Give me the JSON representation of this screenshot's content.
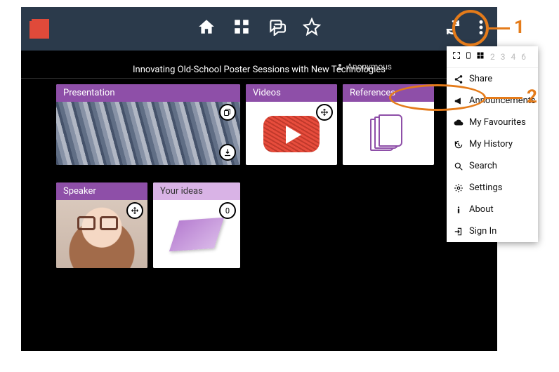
{
  "header": {
    "app_color": "#2b3a4b",
    "logo_color": "#e04a3a"
  },
  "title_bar": {
    "title": "Innovating Old-School Poster Sessions with New Technologies",
    "user_label": "Anonymous"
  },
  "panel": {
    "zoom_levels": [
      "2",
      "3",
      "4",
      "6"
    ],
    "items": [
      {
        "icon": "share-icon",
        "label": "Share"
      },
      {
        "icon": "megaphone-icon",
        "label": "Announcements"
      },
      {
        "icon": "cloud-icon",
        "label": "My Favourites"
      },
      {
        "icon": "history-icon",
        "label": "My History"
      },
      {
        "icon": "search-icon",
        "label": "Search"
      },
      {
        "icon": "gear-icon",
        "label": "Settings"
      },
      {
        "icon": "info-icon",
        "label": "About"
      },
      {
        "icon": "signin-icon",
        "label": "Sign In"
      }
    ]
  },
  "cards": {
    "presentation": {
      "title": "Presentation"
    },
    "videos": {
      "title": "Videos"
    },
    "references": {
      "title": "References"
    },
    "speaker": {
      "title": "Speaker"
    },
    "ideas": {
      "title": "Your ideas",
      "count": "0"
    }
  },
  "annotations": {
    "one": "1",
    "two": "2"
  }
}
